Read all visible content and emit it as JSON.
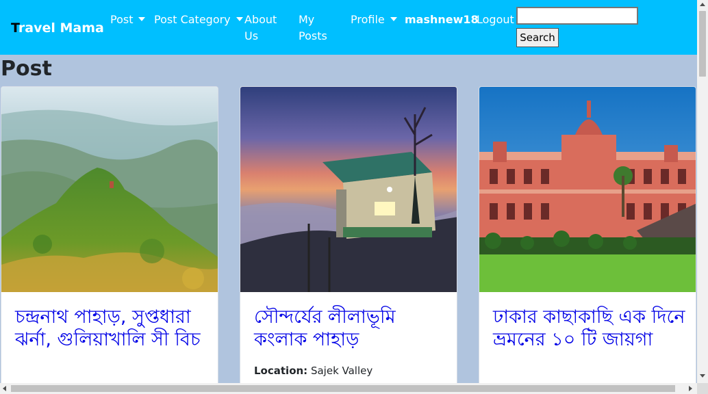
{
  "navbar": {
    "brand_first": "T",
    "brand_rest": "ravel Mama",
    "items": [
      {
        "label": "Post"
      },
      {
        "label": "Post Category"
      },
      {
        "label_line1": "About",
        "label_line2": "Us"
      },
      {
        "label_line1": "My",
        "label_line2": "Posts"
      },
      {
        "label": "Profile"
      }
    ],
    "username": "mashnew18",
    "logout_label": "Logout",
    "search_value": "",
    "search_button": "Search"
  },
  "main": {
    "title": "Post",
    "cards": [
      {
        "title": "চন্দ্রনাথ পাহাড়, সুপ্তধারা ঝর্না, গুলিয়াখালি সী বিচ",
        "image": "green-mountain-photo"
      },
      {
        "title": "সৌন্দর্যের লীলাভূমি কংলাক পাহাড়",
        "image": "hill-cottage-sunset-photo",
        "location_label": "Location:",
        "location_value": "Sajek Valley"
      },
      {
        "title": "ঢাকার কাছাকাছি এক দিনে ভ্রমনের ১০ টি জায়গা",
        "image": "pink-palace-photo"
      }
    ]
  },
  "colors": {
    "navbar_bg": "#00bfff",
    "page_bg": "#b0c4de",
    "card_title": "#0000e6"
  }
}
